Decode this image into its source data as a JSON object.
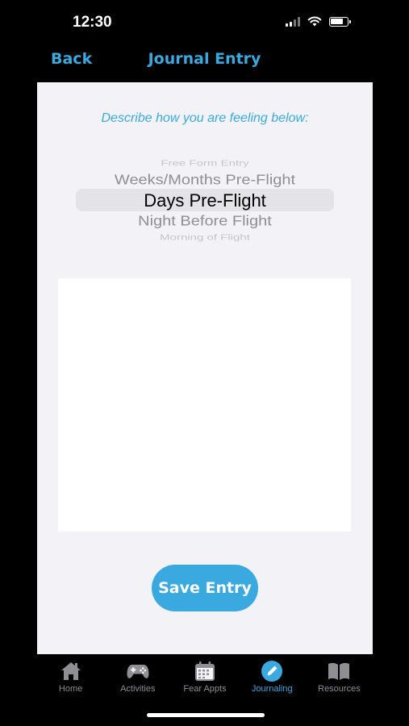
{
  "status_bar": {
    "time": "12:30"
  },
  "nav": {
    "back_label": "Back",
    "title": "Journal Entry"
  },
  "prompt": "Describe how you are feeling below:",
  "picker": {
    "items": [
      "Free Form Entry",
      "Weeks/Months Pre-Flight",
      "Days Pre-Flight",
      "Night Before Flight",
      "Morning of Flight"
    ],
    "selected": "Days Pre-Flight"
  },
  "entry_text": {
    "value": "",
    "placeholder": ""
  },
  "save_label": "Save Entry",
  "tabs": [
    {
      "label": "Home",
      "icon": "home-icon",
      "active": false
    },
    {
      "label": "Activities",
      "icon": "gamepad-icon",
      "active": false
    },
    {
      "label": "Fear Appts",
      "icon": "calendar-icon",
      "active": false
    },
    {
      "label": "Journaling",
      "icon": "pencil-icon",
      "active": true
    },
    {
      "label": "Resources",
      "icon": "book-icon",
      "active": false
    }
  ],
  "colors": {
    "accent": "#3aa9e0",
    "background": "#000000",
    "card": "#f2f2f7",
    "inactive": "#8e8e93"
  }
}
